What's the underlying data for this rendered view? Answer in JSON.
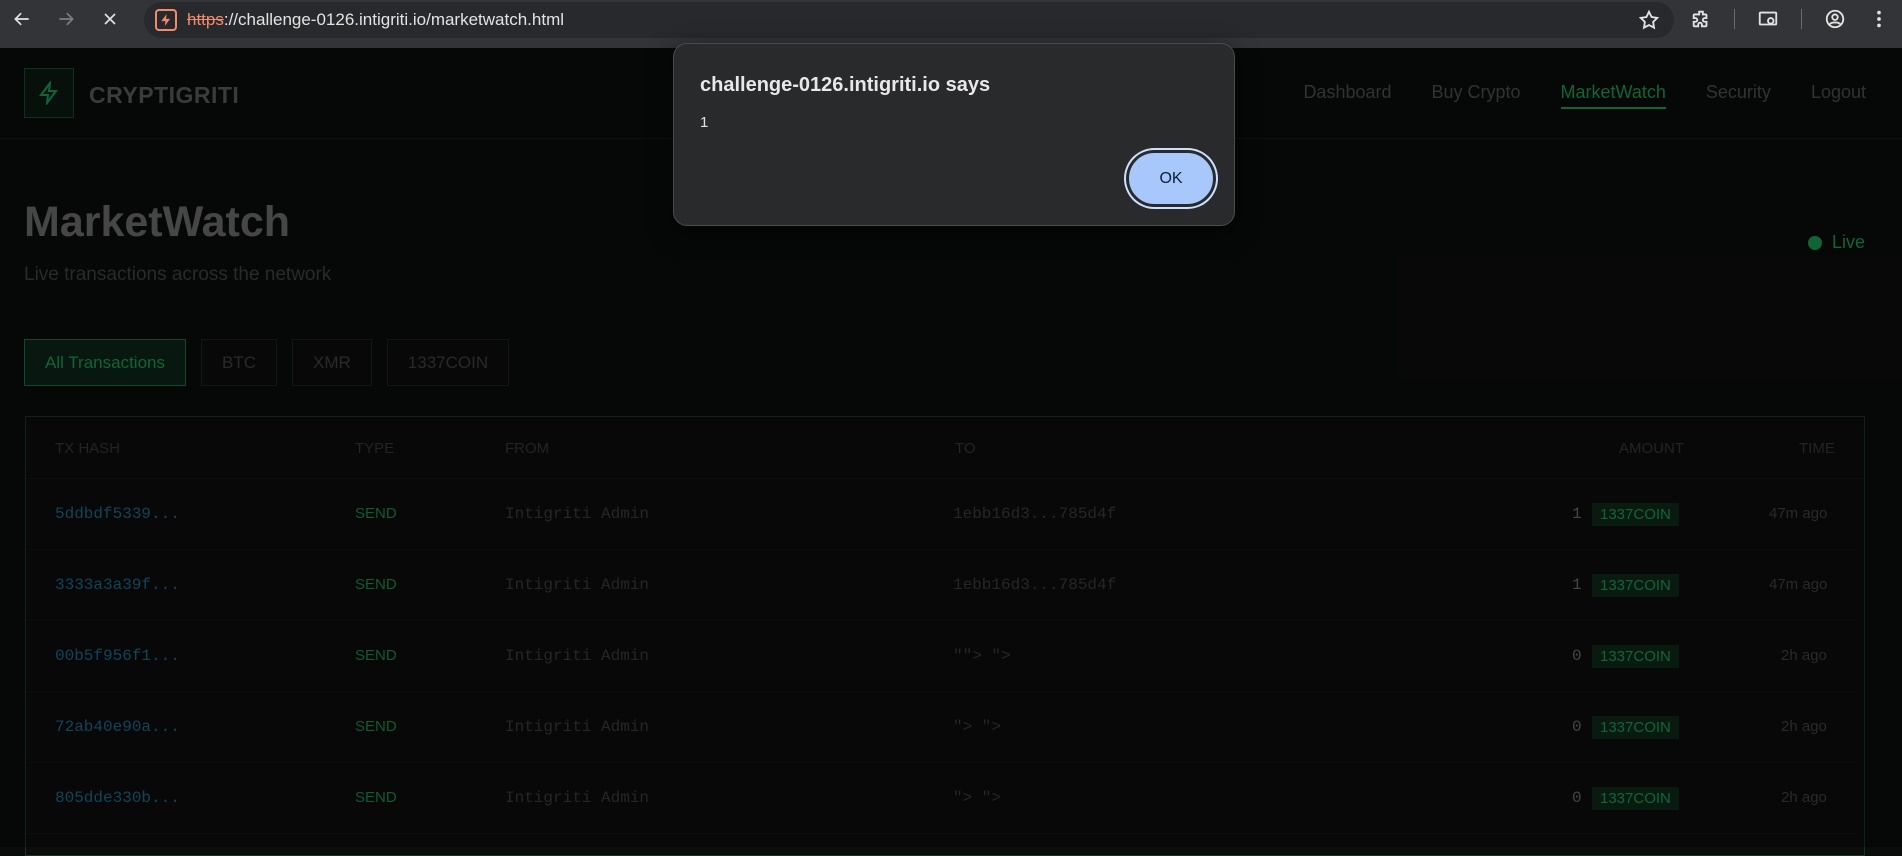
{
  "browser": {
    "url_scheme": "https",
    "url_rest": "://challenge-0126.intigriti.io/marketwatch.html"
  },
  "app": {
    "brand": "CRYPTIGRITI",
    "nav": [
      "Dashboard",
      "Buy Crypto",
      "MarketWatch",
      "Security",
      "Logout"
    ],
    "active_nav": "MarketWatch",
    "accent": "#1a9c55"
  },
  "header": {
    "title": "MarketWatch",
    "subtitle": "Live transactions across the network",
    "live_label": "Live"
  },
  "filters": [
    "All Transactions",
    "BTC",
    "XMR",
    "1337COIN"
  ],
  "table": {
    "columns": [
      "TX HASH",
      "TYPE",
      "FROM",
      "TO",
      "AMOUNT",
      "TIME"
    ],
    "rows": [
      {
        "hash": "5ddbdf5339...",
        "type": "SEND",
        "from": "Intigriti Admin",
        "to": "1ebb16d3...785d4f",
        "amount": "1",
        "coin": "1337COIN",
        "time": "47m ago"
      },
      {
        "hash": "3333a3a39f...",
        "type": "SEND",
        "from": "Intigriti Admin",
        "to": "1ebb16d3...785d4f",
        "amount": "1",
        "coin": "1337COIN",
        "time": "47m ago"
      },
      {
        "hash": "00b5f956f1...",
        "type": "SEND",
        "from": "Intigriti Admin",
        "to": "\"\"> \">",
        "amount": "0",
        "coin": "1337COIN",
        "time": "2h ago"
      },
      {
        "hash": "72ab40e90a...",
        "type": "SEND",
        "from": "Intigriti Admin",
        "to": "\"> \">",
        "amount": "0",
        "coin": "1337COIN",
        "time": "2h ago"
      },
      {
        "hash": "805dde330b...",
        "type": "SEND",
        "from": "Intigriti Admin",
        "to": "\"> \">",
        "amount": "0",
        "coin": "1337COIN",
        "time": "2h ago"
      }
    ]
  },
  "dialog": {
    "title": "challenge-0126.intigriti.io says",
    "message": "1",
    "ok_label": "OK"
  }
}
